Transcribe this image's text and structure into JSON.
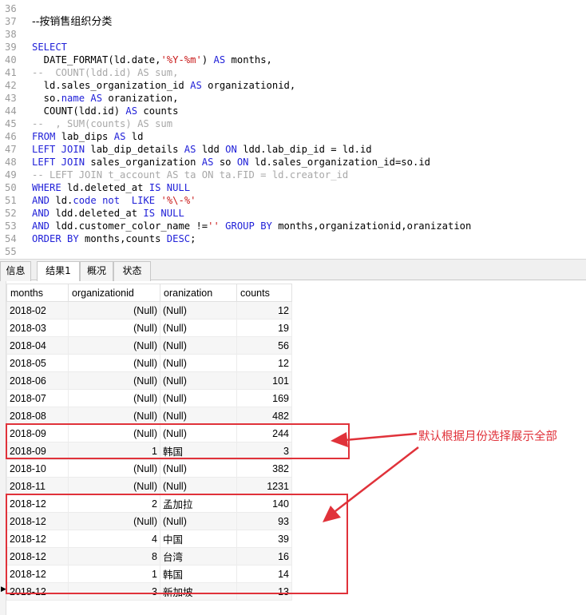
{
  "editor": {
    "lines": [
      {
        "n": "36",
        "t": []
      },
      {
        "n": "37",
        "t": [
          [
            "cn",
            "--按销售组织分类"
          ]
        ]
      },
      {
        "n": "38",
        "t": []
      },
      {
        "n": "39",
        "t": [
          [
            "kw",
            "SELECT"
          ]
        ]
      },
      {
        "n": "40",
        "t": [
          [
            "pl",
            "  DATE_FORMAT(ld.date,"
          ],
          [
            "str",
            "'%Y-%m'"
          ],
          [
            "pl",
            ") "
          ],
          [
            "kw",
            "AS"
          ],
          [
            "pl",
            " months,"
          ]
        ]
      },
      {
        "n": "41",
        "t": [
          [
            "cmt",
            "--  COUNT(ldd.id) AS sum,"
          ]
        ]
      },
      {
        "n": "42",
        "t": [
          [
            "pl",
            "  ld.sales_organization_id "
          ],
          [
            "kw",
            "AS"
          ],
          [
            "pl",
            " organizationid,"
          ]
        ]
      },
      {
        "n": "43",
        "t": [
          [
            "pl",
            "  so."
          ],
          [
            "kw",
            "name"
          ],
          [
            "pl",
            " "
          ],
          [
            "kw",
            "AS"
          ],
          [
            "pl",
            " oranization,"
          ]
        ]
      },
      {
        "n": "44",
        "t": [
          [
            "pl",
            "  COUNT(ldd.id) "
          ],
          [
            "kw",
            "AS"
          ],
          [
            "pl",
            " counts"
          ]
        ]
      },
      {
        "n": "45",
        "t": [
          [
            "cmt",
            "--  , SUM(counts) AS sum"
          ]
        ]
      },
      {
        "n": "46",
        "t": [
          [
            "kw",
            "FROM"
          ],
          [
            "pl",
            " lab_dips "
          ],
          [
            "kw",
            "AS"
          ],
          [
            "pl",
            " ld"
          ]
        ]
      },
      {
        "n": "47",
        "t": [
          [
            "kw",
            "LEFT JOIN"
          ],
          [
            "pl",
            " lab_dip_details "
          ],
          [
            "kw",
            "AS"
          ],
          [
            "pl",
            " ldd "
          ],
          [
            "kw",
            "ON"
          ],
          [
            "pl",
            " ldd.lab_dip_id = ld.id"
          ]
        ]
      },
      {
        "n": "48",
        "t": [
          [
            "kw",
            "LEFT JOIN"
          ],
          [
            "pl",
            " sales_organization "
          ],
          [
            "kw",
            "AS"
          ],
          [
            "pl",
            " so "
          ],
          [
            "kw",
            "ON"
          ],
          [
            "pl",
            " ld.sales_organization_id=so.id"
          ]
        ]
      },
      {
        "n": "49",
        "t": [
          [
            "cmt",
            "-- LEFT JOIN t_account AS ta ON ta.FID = ld.creator_id"
          ]
        ]
      },
      {
        "n": "50",
        "t": [
          [
            "kw",
            "WHERE"
          ],
          [
            "pl",
            " ld.deleted_at "
          ],
          [
            "kw",
            "IS NULL"
          ]
        ]
      },
      {
        "n": "51",
        "t": [
          [
            "kw",
            "AND"
          ],
          [
            "pl",
            " ld."
          ],
          [
            "kw",
            "code"
          ],
          [
            "pl",
            " "
          ],
          [
            "kw",
            "not"
          ],
          [
            "pl",
            "  "
          ],
          [
            "kw",
            "LIKE"
          ],
          [
            "pl",
            " "
          ],
          [
            "str",
            "'%\\-%'"
          ]
        ]
      },
      {
        "n": "52",
        "t": [
          [
            "kw",
            "AND"
          ],
          [
            "pl",
            " ldd.deleted_at "
          ],
          [
            "kw",
            "IS NULL"
          ]
        ]
      },
      {
        "n": "53",
        "t": [
          [
            "kw",
            "AND"
          ],
          [
            "pl",
            " ldd.customer_color_name !="
          ],
          [
            "str",
            "''"
          ],
          [
            "pl",
            " "
          ],
          [
            "kw",
            "GROUP BY"
          ],
          [
            "pl",
            " months,organizationid,oranization"
          ]
        ]
      },
      {
        "n": "54",
        "t": [
          [
            "kw",
            "ORDER BY"
          ],
          [
            "pl",
            " months,counts "
          ],
          [
            "kw",
            "DESC"
          ],
          [
            "pl",
            ";"
          ]
        ]
      },
      {
        "n": "55",
        "t": []
      }
    ]
  },
  "tabs": [
    "信息",
    "结果1",
    "概况",
    "状态"
  ],
  "active_tab": "结果1",
  "grid": {
    "columns": [
      "months",
      "organizationid",
      "oranization",
      "counts"
    ],
    "rows": [
      [
        "2018-02",
        "(Null)",
        "(Null)",
        "12"
      ],
      [
        "2018-03",
        "(Null)",
        "(Null)",
        "19"
      ],
      [
        "2018-04",
        "(Null)",
        "(Null)",
        "56"
      ],
      [
        "2018-05",
        "(Null)",
        "(Null)",
        "12"
      ],
      [
        "2018-06",
        "(Null)",
        "(Null)",
        "101"
      ],
      [
        "2018-07",
        "(Null)",
        "(Null)",
        "169"
      ],
      [
        "2018-08",
        "(Null)",
        "(Null)",
        "482"
      ],
      [
        "2018-09",
        "(Null)",
        "(Null)",
        "244"
      ],
      [
        "2018-09",
        "1",
        "韩国",
        "3"
      ],
      [
        "2018-10",
        "(Null)",
        "(Null)",
        "382"
      ],
      [
        "2018-11",
        "(Null)",
        "(Null)",
        "1231"
      ],
      [
        "2018-12",
        "2",
        "孟加拉",
        "140"
      ],
      [
        "2018-12",
        "(Null)",
        "(Null)",
        "93"
      ],
      [
        "2018-12",
        "4",
        "中国",
        "39"
      ],
      [
        "2018-12",
        "8",
        "台湾",
        "16"
      ],
      [
        "2018-12",
        "1",
        "韩国",
        "14"
      ],
      [
        "2018-12",
        "3",
        "新加坡",
        "13"
      ]
    ]
  },
  "annotation": {
    "note": "默认根据月份选择展示全部",
    "color": "#e0323a"
  },
  "colors": {
    "keyword": "#1f1fd8",
    "string": "#c81818",
    "comment": "#a8a8a8",
    "null_text": "#c8c8c8"
  }
}
